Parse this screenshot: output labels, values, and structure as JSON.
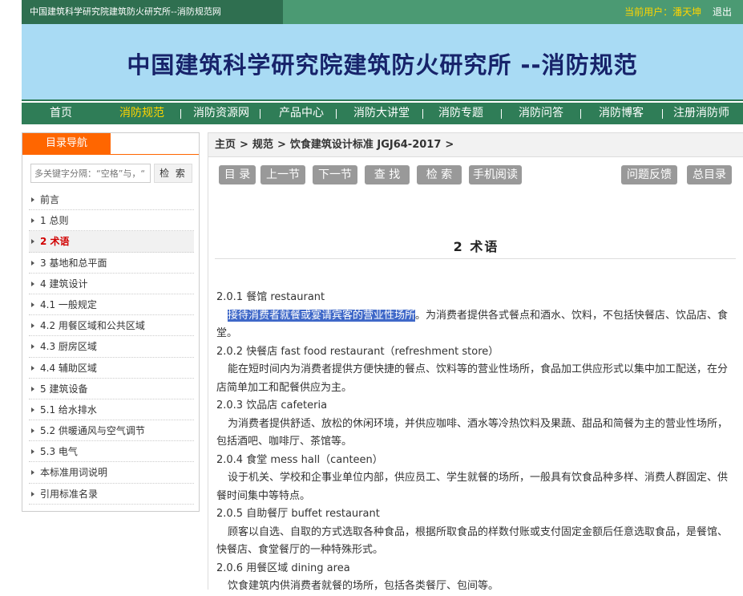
{
  "topbar": {
    "site_title": "中国建筑科学研究院建筑防火研究所--消防规范网",
    "current_user_label": "当前用户：潘天坤",
    "logout": "退出"
  },
  "banner": {
    "title": "中国建筑科学研究院建筑防火研究所 --消防规范"
  },
  "nav": {
    "items": [
      "首页",
      "消防规范",
      "消防资源网",
      "产品中心",
      "消防大讲堂",
      "消防专题",
      "消防问答",
      "消防博客",
      "注册消防师"
    ],
    "active": "消防规范"
  },
  "sidebar": {
    "tab": "目录导航",
    "search_placeholder": "多关键字分隔：“空格”与，“",
    "search_button": "检 索",
    "items": [
      "前言",
      "1 总则",
      "2 术语",
      "3 基地和总平面",
      "4 建筑设计",
      "4.1 一般规定",
      "4.2 用餐区域和公共区域",
      "4.3 厨房区域",
      "4.4 辅助区域",
      "5 建筑设备",
      "5.1 给水排水",
      "5.2 供暖通风与空气调节",
      "5.3 电气",
      "本标准用词说明",
      "引用标准名录"
    ],
    "active": "2 术语"
  },
  "breadcrumb": {
    "home": "主页",
    "sep": ">",
    "level1": "规范",
    "level2": "饮食建筑设计标准 JGJ64-2017",
    "trail": ">"
  },
  "toolbar": {
    "toc": "目 录",
    "prev": "上一节",
    "next": "下一节",
    "find": "查 找",
    "search": "检 索",
    "mobile": "手机阅读",
    "feedback": "问题反馈",
    "all_toc": "总目录"
  },
  "section": {
    "title": "2  术语",
    "t1_head": "2.0.1 餐馆 restaurant",
    "t1_hl": "接待消费者就餐或宴请宾客的营业性场所",
    "t1_rest": "。为消费者提供各式餐点和酒水、饮料，不包括快餐店、饮品店、食堂。",
    "t2_head": "2.0.2 快餐店 fast food restaurant（refreshment store）",
    "t2_body": "能在短时间内为消费者提供方便快捷的餐点、饮料等的营业性场所，食品加工供应形式以集中加工配送，在分店简单加工和配餐供应为主。",
    "t3_head": "2.0.3 饮品店 cafeteria",
    "t3_body": "为消费者提供舒适、放松的休闲环境，并供应咖啡、酒水等冷热饮料及果蔬、甜品和简餐为主的营业性场所，包括酒吧、咖啡厅、茶馆等。",
    "t4_head": "2.0.4 食堂 mess hall（canteen）",
    "t4_body": "设于机关、学校和企事业单位内部，供应员工、学生就餐的场所，一般具有饮食品种多样、消费人群固定、供餐时间集中等特点。",
    "t5_head": "2.0.5 自助餐厅 buffet restaurant",
    "t5_body": "顾客以自选、自取的方式选取各种食品，根据所取食品的样数付账或支付固定金额后任意选取食品，是餐馆、快餐店、食堂餐厅的一种特殊形式。",
    "t6_head": "2.0.6 用餐区域 dining area",
    "t6_body": "饮食建筑内供消费者就餐的场所，包括各类餐厅、包间等。"
  }
}
